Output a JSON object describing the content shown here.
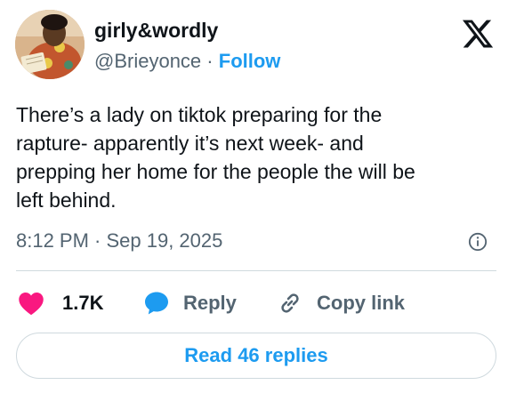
{
  "author": {
    "display_name": "girly&wordly",
    "handle": "@Brieyonce",
    "separator": "·",
    "follow_label": "Follow"
  },
  "tweet": {
    "text": "There’s a lady on tiktok preparing for the\nrapture- apparently it’s next week- and\nprepping her home for the people the will be\nleft behind.",
    "timestamp": "8:12 PM · Sep 19, 2025"
  },
  "actions": {
    "like_count": "1.7K",
    "reply_label": "Reply",
    "copy_link_label": "Copy link"
  },
  "footer": {
    "read_replies_label": "Read 46 replies"
  },
  "icons": {
    "brand": "x-logo-icon",
    "info": "info-icon",
    "like": "heart-icon",
    "reply": "speech-bubble-icon",
    "copy": "link-icon"
  },
  "colors": {
    "accent": "#1d9bf0",
    "like": "#f91880",
    "text_primary": "#0f1419",
    "text_secondary": "#536471",
    "border": "#cfd9de"
  }
}
